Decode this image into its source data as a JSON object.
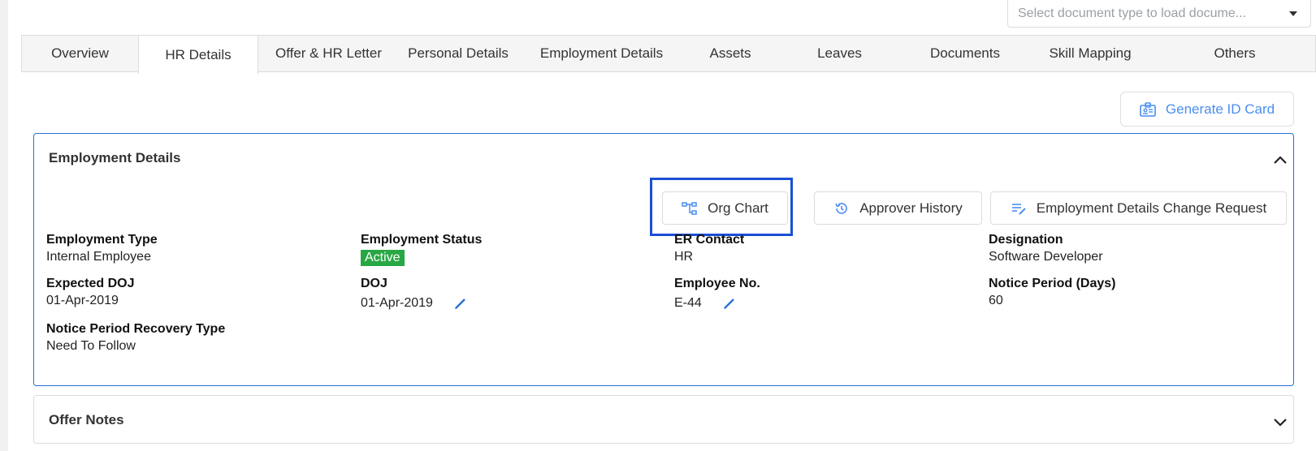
{
  "doc_select": {
    "placeholder": "Select document type to load docume..."
  },
  "tabs": [
    {
      "label": "Overview"
    },
    {
      "label": "HR Details"
    },
    {
      "label": "Offer & HR Letter"
    },
    {
      "label": "Personal Details"
    },
    {
      "label": "Employment Details"
    },
    {
      "label": "Assets"
    },
    {
      "label": "Leaves"
    },
    {
      "label": "Documents"
    },
    {
      "label": "Skill Mapping"
    },
    {
      "label": "Others"
    }
  ],
  "active_tab": "HR Details",
  "generate_id_card": {
    "label": "Generate ID Card",
    "icon": "id-card-icon"
  },
  "employment_panel": {
    "title": "Employment Details",
    "actions": {
      "org_chart": "Org Chart",
      "approver_history": "Approver History",
      "change_request": "Employment Details Change Request"
    },
    "fields": {
      "employment_type": {
        "label": "Employment Type",
        "value": "Internal Employee"
      },
      "employment_status": {
        "label": "Employment Status",
        "value": "Active"
      },
      "er_contact": {
        "label": "ER Contact",
        "value": "HR"
      },
      "designation": {
        "label": "Designation",
        "value": "Software Developer"
      },
      "expected_doj": {
        "label": "Expected DOJ",
        "value": "01-Apr-2019"
      },
      "doj": {
        "label": "DOJ",
        "value": "01-Apr-2019"
      },
      "employee_no": {
        "label": "Employee No.",
        "value": "E-44"
      },
      "notice_period": {
        "label": "Notice Period (Days)",
        "value": "60"
      },
      "notice_recovery": {
        "label": "Notice Period Recovery Type",
        "value": "Need To Follow"
      }
    }
  },
  "offer_panel": {
    "title": "Offer Notes"
  },
  "colors": {
    "accent": "#2a6fd6",
    "link": "#4a8ef0",
    "status_active": "#28a745",
    "highlight": "#1a4fd6"
  }
}
